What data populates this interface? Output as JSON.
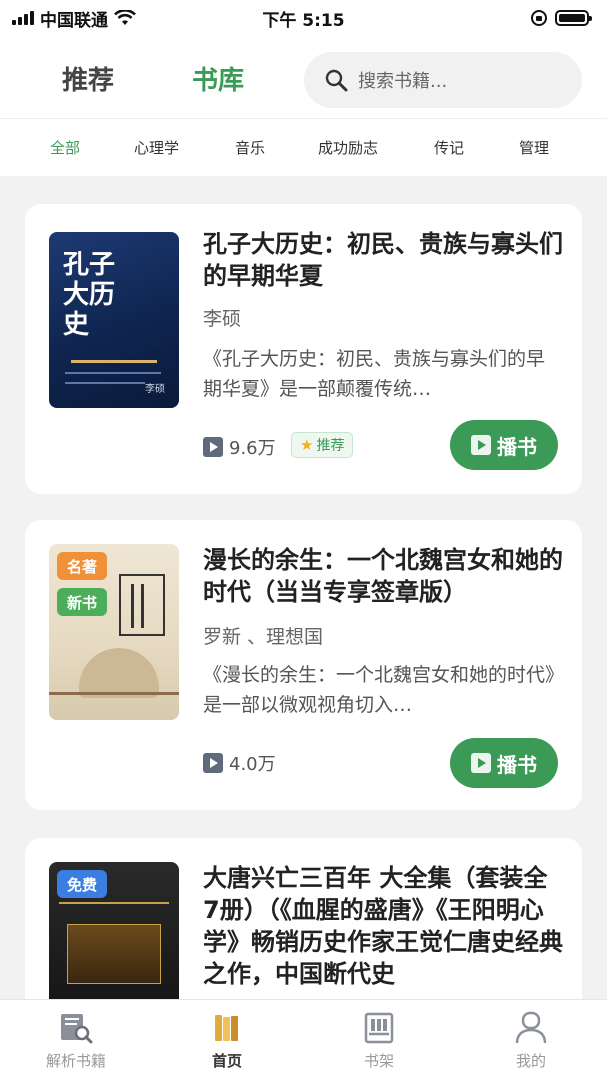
{
  "status_bar": {
    "carrier": "中国联通",
    "time": "下午 5:15"
  },
  "header": {
    "tabs": [
      {
        "label": "推荐",
        "active": false
      },
      {
        "label": "书库",
        "active": true
      }
    ],
    "search": {
      "placeholder": "搜索书籍..."
    }
  },
  "categories": [
    {
      "label": "全部",
      "active": true
    },
    {
      "label": "心理学",
      "active": false
    },
    {
      "label": "音乐",
      "active": false
    },
    {
      "label": "成功励志",
      "active": false
    },
    {
      "label": "传记",
      "active": false
    },
    {
      "label": "管理",
      "active": false
    }
  ],
  "books": [
    {
      "title": "孔子大历史：初民、贵族与寡头们的早期华夏",
      "author": "李硕",
      "description": "《孔子大历史：初民、贵族与寡头们的早期华夏》是一部颠覆传统…",
      "plays": "9.6万",
      "recommend_badge": "推荐",
      "play_label": "播书",
      "cover_text": "孔子大历史",
      "cover_author": "李硕",
      "tags": []
    },
    {
      "title": "漫长的余生：一个北魏宫女和她的时代（当当专享签章版）",
      "author": "罗新 、理想国",
      "description": "《漫长的余生：一个北魏宫女和她的时代》是一部以微观视角切入…",
      "plays": "4.0万",
      "play_label": "播书",
      "tags": [
        "名著",
        "新书"
      ]
    },
    {
      "title": "大唐兴亡三百年 大全集（套装全7册）（《血腥的盛唐》《王阳明心学》畅销历史作家王觉仁唐史经典之作，中国断代史",
      "tags": [
        "免费"
      ]
    }
  ],
  "bottom_nav": [
    {
      "label": "解析书籍",
      "active": false
    },
    {
      "label": "首页",
      "active": true
    },
    {
      "label": "书架",
      "active": false
    },
    {
      "label": "我的",
      "active": false
    }
  ],
  "colors": {
    "accent": "#3a9a56",
    "tag_orange": "#f0913a",
    "tag_green": "#4cae5a",
    "tag_blue": "#3b7de0"
  }
}
